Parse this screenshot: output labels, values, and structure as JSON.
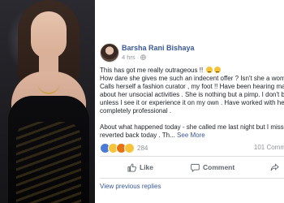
{
  "post": {
    "author": "Barsha Rani Bishaya",
    "time": "4 hrs",
    "time_separator": "·",
    "lines": [
      "This has got me really outrageous !!",
      "How dare she gives me such an indecent offer ? Isn't she a wom",
      "Calls herself a fashion curator , my foot !! Have been hearing ma",
      "about her unsocial activities . She is nothing but a pimp. I don't b",
      "unless I see it or experience it on my own . Have worked with he",
      "completely professional .",
      "About what happened today - she called me last night but I miss",
      "reverted back today . Th..."
    ],
    "see_more": "See More"
  },
  "reactions": {
    "count": "284"
  },
  "comments": {
    "count": "101 Comm"
  },
  "actions": {
    "like": "Like",
    "comment": "Comment"
  },
  "footer": {
    "previous_replies": "View previous replies"
  },
  "colors": {
    "link": "#385898",
    "muted": "#90949c",
    "text": "#1d2129",
    "icon": "#606770"
  }
}
